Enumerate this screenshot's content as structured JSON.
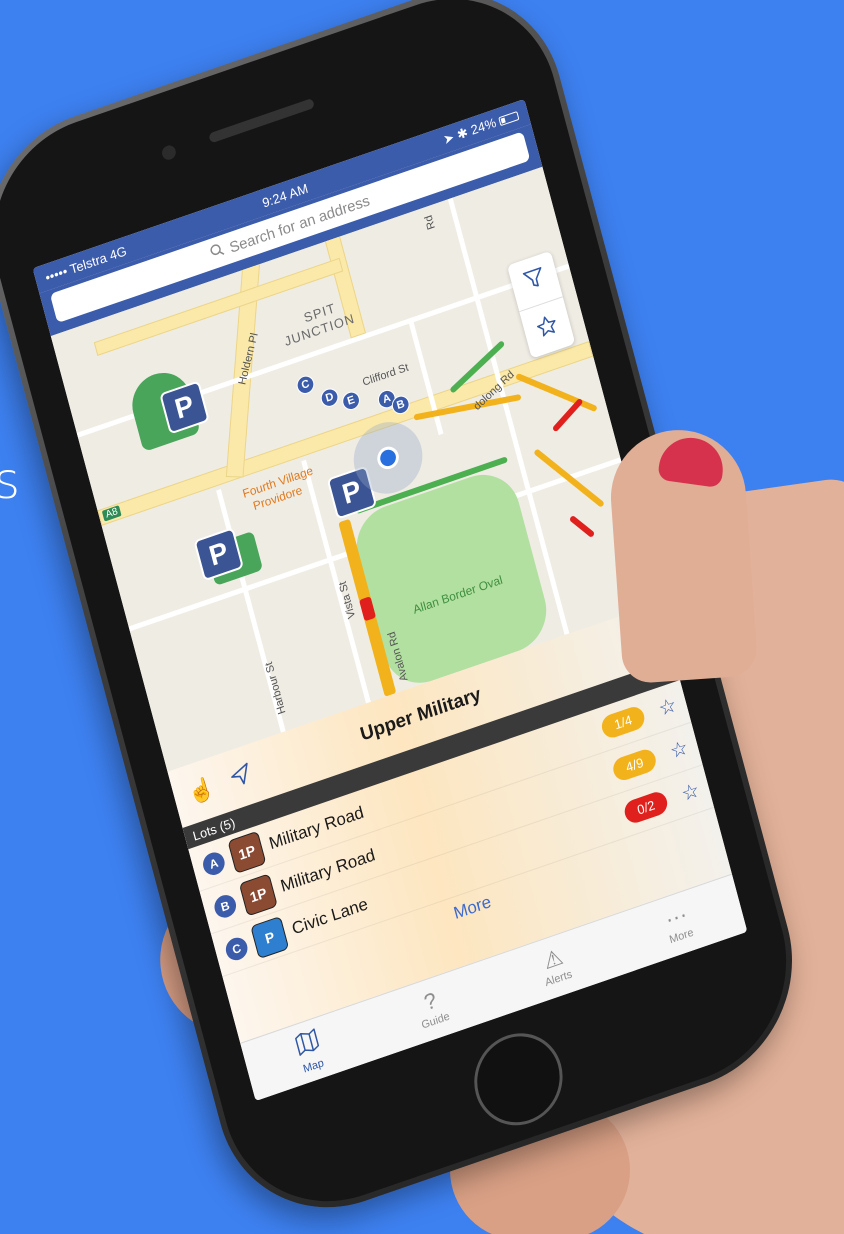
{
  "edge_text": "s",
  "status": {
    "carrier": "••••• Telstra 4G",
    "time": "9:24 AM",
    "battery": "24%"
  },
  "search": {
    "placeholder": "Search for an address"
  },
  "map": {
    "labels": {
      "spit": "SPIT",
      "junction": "JUNCTION",
      "clifford": "Clifford St",
      "dolong": "dolong Rd",
      "fourth1": "Fourth Village",
      "fourth2": "Providore",
      "allan": "Allan Border Oval",
      "vista": "Vista St",
      "harbour": "Harbour St",
      "avalon": "Avalon Rd",
      "a8": "A8",
      "rd": "Rd",
      "holdern": "Holdern Pl"
    },
    "markers": {
      "p": "P"
    },
    "pins": [
      "C",
      "D",
      "E",
      "A",
      "B"
    ],
    "controls": [
      "filter-icon",
      "star-icon"
    ]
  },
  "sheet": {
    "title": "Upper Military",
    "section": "Lots (5)",
    "lots": [
      {
        "letter": "A",
        "type": "1P",
        "name": "Military Road",
        "availability": "1/4",
        "badge_color": "#f2b21b",
        "icon_color": "#8b4a32"
      },
      {
        "letter": "B",
        "type": "1P",
        "name": "Military Road",
        "availability": "4/9",
        "badge_color": "#f2b21b",
        "icon_color": "#8b4a32"
      },
      {
        "letter": "C",
        "type": "P",
        "name": "Civic Lane",
        "availability": "0/2",
        "badge_color": "#e0201d",
        "icon_color": "#2e7fd0"
      }
    ],
    "more": "More"
  },
  "tabs": [
    {
      "label": "Map",
      "icon": "map-icon",
      "active": true
    },
    {
      "label": "Guide",
      "icon": "question-icon",
      "active": false
    },
    {
      "label": "Alerts",
      "icon": "alert-icon",
      "active": false
    },
    {
      "label": "More",
      "icon": "more-icon",
      "active": false
    }
  ],
  "colors": {
    "background": "#3d80f0",
    "navbar": "#3b5bab",
    "available_high": "#f2b21b",
    "available_none": "#e0201d",
    "street_green": "#4caf50"
  }
}
